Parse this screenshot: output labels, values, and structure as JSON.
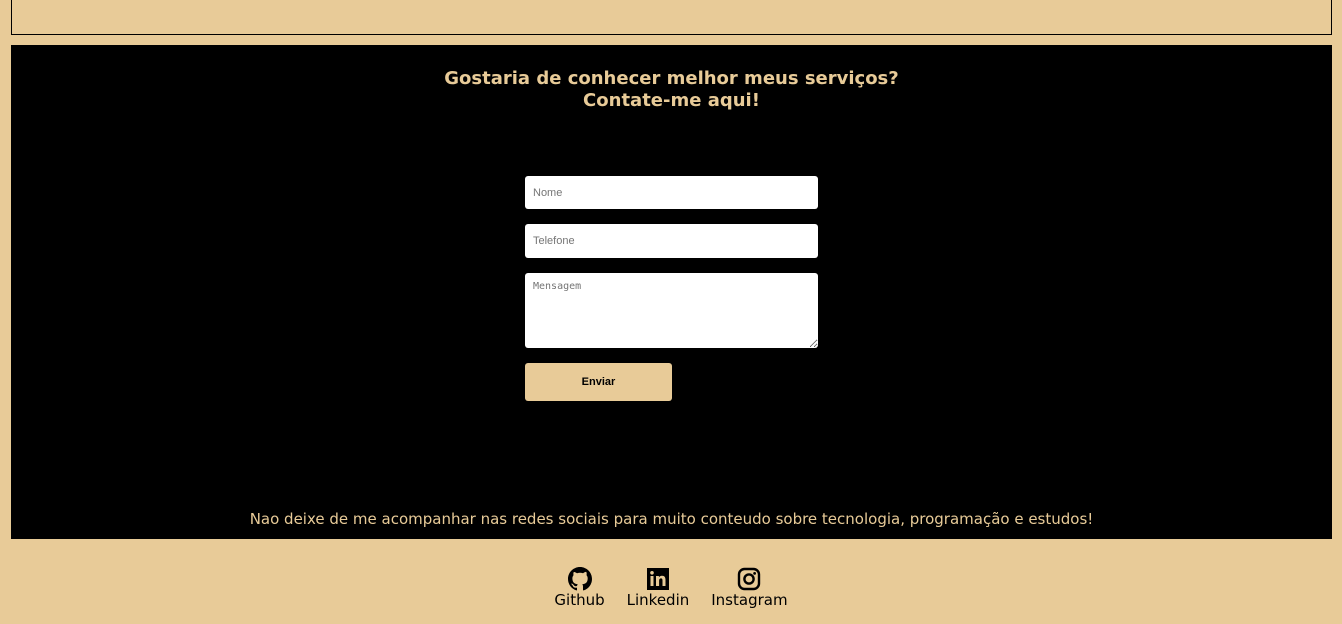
{
  "contact": {
    "title_line1": "Gostaria de conhecer melhor meus serviços?",
    "title_line2": "Contate-me aqui!",
    "form": {
      "name_placeholder": "Nome",
      "phone_placeholder": "Telefone",
      "message_placeholder": "Mensagem",
      "submit_label": "Enviar"
    },
    "social_text": "Nao deixe de me acompanhar nas redes sociais para muito conteudo sobre tecnologia, programação e estudos!"
  },
  "socials": [
    {
      "label": "Github",
      "icon": "github-icon"
    },
    {
      "label": "Linkedin",
      "icon": "linkedin-icon"
    },
    {
      "label": "Instagram",
      "icon": "instagram-icon"
    }
  ],
  "colors": {
    "background": "#e8cb98",
    "section": "#000000",
    "accent_text": "#e8cb98"
  }
}
